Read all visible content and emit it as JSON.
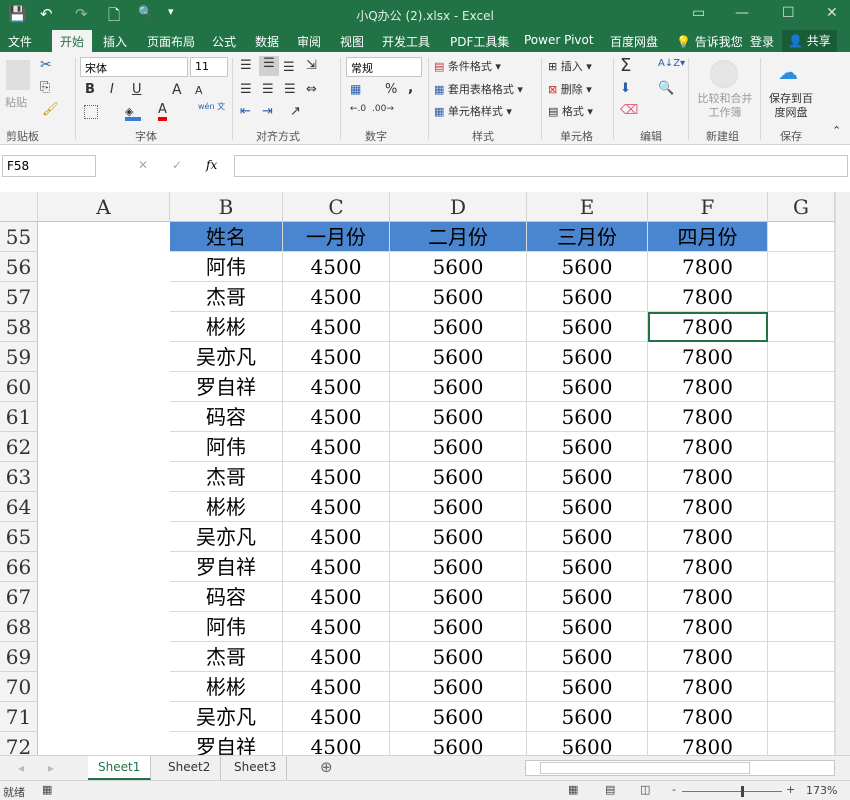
{
  "titlebar": {
    "title": "小Q办公 (2).xlsx - Excel",
    "save": "💾",
    "undo": "↶",
    "redo": "↷",
    "new": "🗋",
    "preview": "🔍",
    "more": "▾",
    "restore": "▭",
    "min": "—",
    "max": "☐",
    "close": "✕"
  },
  "tabs": [
    "文件",
    "开始",
    "插入",
    "页面布局",
    "公式",
    "数据",
    "审阅",
    "视图",
    "开发工具",
    "PDF工具集",
    "Power Pivot",
    "百度网盘"
  ],
  "tell_me": "告诉我您",
  "login": "登录",
  "share": "共享",
  "ribbon": {
    "clipboard": {
      "paste": "粘贴",
      "label": "剪贴板"
    },
    "font": {
      "name": "宋体",
      "size": "11",
      "label": "字体",
      "bold": "B",
      "italic": "I",
      "underline": "U",
      "grow": "A",
      "shrink": "A",
      "fontcolor": "A",
      "wen": "wén 文"
    },
    "align": {
      "label": "对齐方式"
    },
    "number": {
      "format": "常规",
      "percent": "%",
      "comma": ",",
      "label": "数字"
    },
    "styles": {
      "cond": "条件格式",
      "table": "套用表格格式",
      "cell": "单元格样式",
      "label": "样式"
    },
    "cells": {
      "insert": "插入",
      "delete": "删除",
      "format": "格式",
      "label": "单元格"
    },
    "editing": {
      "sum": "Σ",
      "label": "编辑"
    },
    "newgroup": {
      "btn": "比较和合并工作簿",
      "label": "新建组"
    },
    "save": {
      "btn": "保存到百度网盘",
      "label": "保存"
    }
  },
  "formula": {
    "namebox": "F58",
    "cancel": "✕",
    "enter": "✓",
    "fx": "fx",
    "value": ""
  },
  "columns": [
    "A",
    "B",
    "C",
    "D",
    "E",
    "F",
    "G"
  ],
  "header_row": {
    "num": "55",
    "cells": [
      "姓名",
      "一月份",
      "二月份",
      "三月份",
      "四月份",
      ""
    ]
  },
  "rows": [
    {
      "num": "56",
      "cells": [
        "阿伟",
        "4500",
        "5600",
        "5600",
        "7800",
        ""
      ]
    },
    {
      "num": "57",
      "cells": [
        "杰哥",
        "4500",
        "5600",
        "5600",
        "7800",
        ""
      ]
    },
    {
      "num": "58",
      "cells": [
        "彬彬",
        "4500",
        "5600",
        "5600",
        "7800",
        ""
      ]
    },
    {
      "num": "59",
      "cells": [
        "吴亦凡",
        "4500",
        "5600",
        "5600",
        "7800",
        ""
      ]
    },
    {
      "num": "60",
      "cells": [
        "罗自祥",
        "4500",
        "5600",
        "5600",
        "7800",
        ""
      ]
    },
    {
      "num": "61",
      "cells": [
        "码容",
        "4500",
        "5600",
        "5600",
        "7800",
        ""
      ]
    },
    {
      "num": "62",
      "cells": [
        "阿伟",
        "4500",
        "5600",
        "5600",
        "7800",
        ""
      ]
    },
    {
      "num": "63",
      "cells": [
        "杰哥",
        "4500",
        "5600",
        "5600",
        "7800",
        ""
      ]
    },
    {
      "num": "64",
      "cells": [
        "彬彬",
        "4500",
        "5600",
        "5600",
        "7800",
        ""
      ]
    },
    {
      "num": "65",
      "cells": [
        "吴亦凡",
        "4500",
        "5600",
        "5600",
        "7800",
        ""
      ]
    },
    {
      "num": "66",
      "cells": [
        "罗自祥",
        "4500",
        "5600",
        "5600",
        "7800",
        ""
      ]
    },
    {
      "num": "67",
      "cells": [
        "码容",
        "4500",
        "5600",
        "5600",
        "7800",
        ""
      ]
    },
    {
      "num": "68",
      "cells": [
        "阿伟",
        "4500",
        "5600",
        "5600",
        "7800",
        ""
      ]
    },
    {
      "num": "69",
      "cells": [
        "杰哥",
        "4500",
        "5600",
        "5600",
        "7800",
        ""
      ]
    },
    {
      "num": "70",
      "cells": [
        "彬彬",
        "4500",
        "5600",
        "5600",
        "7800",
        ""
      ]
    },
    {
      "num": "71",
      "cells": [
        "吴亦凡",
        "4500",
        "5600",
        "5600",
        "7800",
        ""
      ]
    },
    {
      "num": "72",
      "cells": [
        "罗自祥",
        "4500",
        "5600",
        "5600",
        "7800",
        ""
      ]
    }
  ],
  "sheets": [
    "Sheet1",
    "Sheet2",
    "Sheet3"
  ],
  "status": {
    "ready": "就绪",
    "zoom": "173%",
    "minus": "-",
    "plus": "+"
  },
  "colors": {
    "brand": "#217346",
    "header_fill": "#4a86cf"
  }
}
